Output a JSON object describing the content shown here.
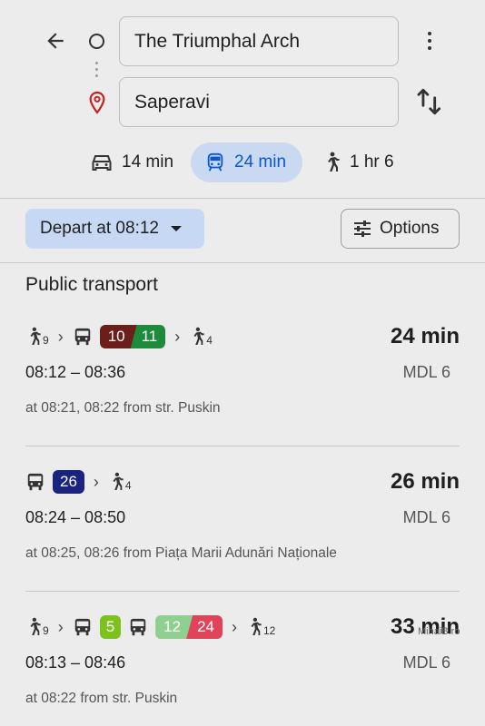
{
  "search": {
    "origin": "The Triumphal Arch",
    "destination": "Saperavi"
  },
  "modes": [
    {
      "name": "car",
      "label": "14 min"
    },
    {
      "name": "transit",
      "label": "24 min",
      "selected": true
    },
    {
      "name": "walk",
      "label": "1 hr 6"
    }
  ],
  "controls": {
    "depart_label": "Depart at 08:12",
    "options_label": "Options"
  },
  "section_title": "Public transport",
  "routes": [
    {
      "walk_start": "9",
      "lines": [
        "10",
        "11"
      ],
      "walk_end": "4",
      "duration": "24 min",
      "times": "08:12 – 08:36",
      "fare": "MDL 6",
      "from": "at 08:21, 08:22 from str. Puskin"
    },
    {
      "lines": [
        "26"
      ],
      "walk_end": "4",
      "duration": "26 min",
      "times": "08:24 – 08:50",
      "fare": "MDL 6",
      "from": "at 08:25, 08:26 from Piața Marii Adunări Naționale"
    },
    {
      "walk_start": "9",
      "lines": [
        "5",
        "12",
        "24"
      ],
      "walk_end": "12",
      "duration": "33 min",
      "times": "08:13 – 08:46",
      "fare": "MDL 6",
      "from": "at 08:22 from str. Puskin"
    }
  ],
  "colors": {
    "accent": "#0b57d0",
    "line_10": "#6b1e1a",
    "line_11": "#1e8a3c",
    "line_26": "#1a237e",
    "line_5": "#7cc21c",
    "line_12": "#8fcf8f",
    "line_24": "#e0445a"
  },
  "watermark": "MihaiB.ro"
}
